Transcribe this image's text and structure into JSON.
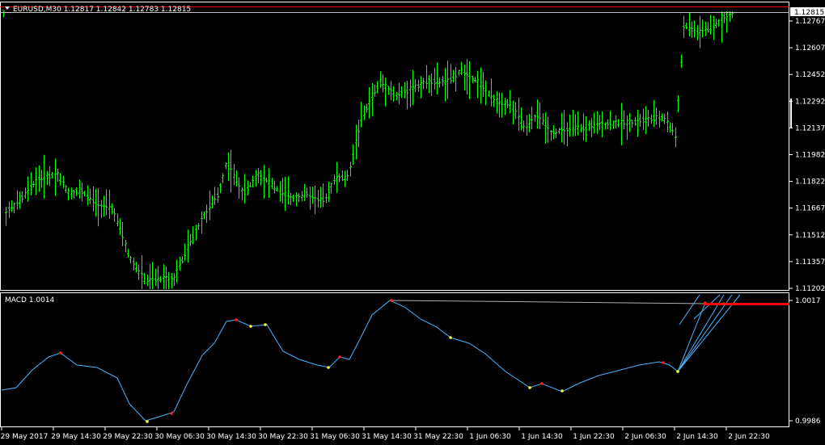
{
  "window": {
    "symbol_title": "EURUSD,M30  1.12817 1.12842 1.12783 1.12815",
    "menu_icon": "triangle-down-icon"
  },
  "colors": {
    "background": "#000000",
    "bars": "#00ff00",
    "frame": "#ffffff",
    "macd_line": "#4ab4ff",
    "bid_line": "#ff0000",
    "price_label_bg": "#ffffff",
    "signal_red": "#ff2020",
    "signal_yellow": "#ffff40"
  },
  "price_axis": {
    "ticks": [
      "1.12767",
      "1.12607",
      "1.12452",
      "1.12292",
      "1.12137",
      "1.11982",
      "1.11822",
      "1.11667",
      "1.11512",
      "1.11357",
      "1.11202"
    ],
    "current_price": "1.12815"
  },
  "macd": {
    "title": "MACD 1.0014",
    "axis_ticks": [
      "1.0017",
      "0.9986"
    ]
  },
  "time_axis": {
    "labels": [
      "29 May 2017",
      "29 May 14:30",
      "29 May 22:30",
      "30 May 06:30",
      "30 May 14:30",
      "30 May 22:30",
      "31 May 06:30",
      "31 May 14:30",
      "31 May 22:30",
      "1 Jun 06:30",
      "1 Jun 14:30",
      "1 Jun 22:30",
      "2 Jun 06:30",
      "2 Jun 14:30",
      "2 Jun 22:30"
    ]
  },
  "chart_data": {
    "type": "line",
    "title": "EURUSD,M30  1.12817 1.12842 1.12783 1.12815",
    "ylim": [
      1.1115,
      1.1285
    ],
    "x": [
      "29 May 2017",
      "29 May 14:30",
      "29 May 22:30",
      "30 May 06:30",
      "30 May 14:30",
      "30 May 22:30",
      "31 May 06:30",
      "31 May 14:30",
      "31 May 22:30",
      "1 Jun 06:30",
      "1 Jun 14:30",
      "1 Jun 22:30",
      "2 Jun 06:30",
      "2 Jun 14:30",
      "2 Jun 22:30"
    ],
    "series": [
      {
        "values": [
          1.1165,
          1.118,
          1.117,
          1.112,
          1.1185,
          1.1175,
          1.1192,
          1.1238,
          1.1245,
          1.122,
          1.121,
          1.1215,
          1.122,
          1.1275,
          1.1282
        ]
      },
      {
        "values": [
          0.9995,
          1.0004,
          0.9999,
          0.9988,
          1.001,
          1.0007,
          1.0002,
          1.0017,
          1.001,
          1.0001,
          0.9995,
          0.9999,
          1.0002,
          1.0,
          1.0015
        ]
      }
    ]
  }
}
